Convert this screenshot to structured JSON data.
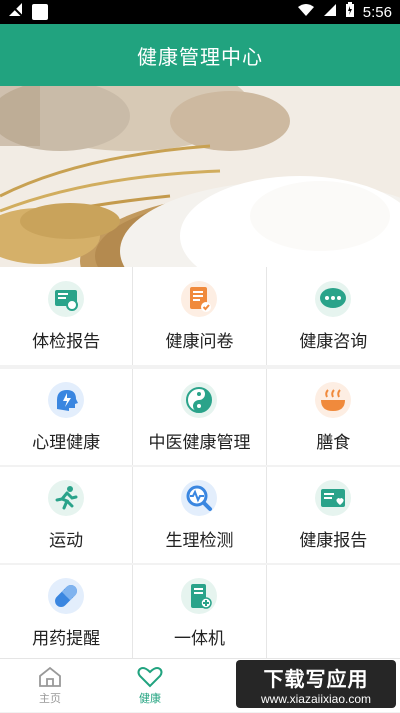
{
  "status_bar": {
    "time": "5:56"
  },
  "header": {
    "title": "健康管理中心"
  },
  "grid": [
    {
      "label": "体检报告",
      "icon": "checkup-report-icon"
    },
    {
      "label": "健康问卷",
      "icon": "questionnaire-icon"
    },
    {
      "label": "健康咨询",
      "icon": "chat-icon"
    },
    {
      "label": "心理健康",
      "icon": "brain-icon"
    },
    {
      "label": "中医健康管理",
      "icon": "yin-yang-icon"
    },
    {
      "label": "膳食",
      "icon": "bowl-icon"
    },
    {
      "label": "运动",
      "icon": "running-icon"
    },
    {
      "label": "生理检测",
      "icon": "magnifier-pulse-icon"
    },
    {
      "label": "健康报告",
      "icon": "heart-report-icon"
    },
    {
      "label": "用药提醒",
      "icon": "capsule-icon"
    },
    {
      "label": "一体机",
      "icon": "device-icon"
    }
  ],
  "bottom_nav": {
    "tabs": [
      {
        "label": "主页",
        "icon": "home-icon",
        "active": false
      },
      {
        "label": "健康",
        "icon": "heart-icon",
        "active": true
      }
    ]
  },
  "watermark": {
    "title": "下载写应用",
    "url": "www.xiazaiixiao.com"
  },
  "colors": {
    "brand": "#21a37f",
    "teal": "#2aa38a"
  }
}
